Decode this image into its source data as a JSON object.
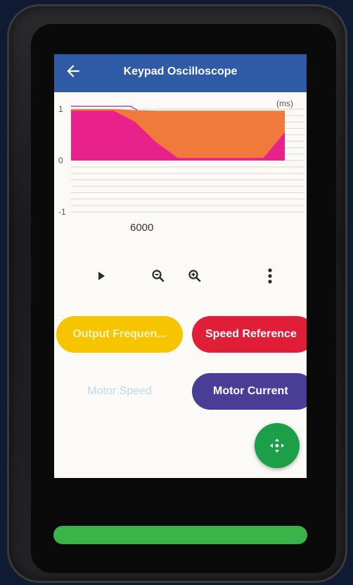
{
  "appbar": {
    "title": "Keypad Oscilloscope",
    "back_icon": "arrow-left-icon"
  },
  "chart": {
    "unit_label": "(ms)",
    "y_ticks": [
      "1",
      "0",
      "-1"
    ],
    "time_value": "6000"
  },
  "chart_data": {
    "type": "area",
    "title": "",
    "xlabel": "(ms)",
    "ylabel": "",
    "ylim": [
      -1,
      1
    ],
    "y_ticks": [
      1,
      0,
      -1
    ],
    "x": [
      0,
      1,
      2,
      3,
      4,
      5,
      6,
      7,
      8,
      9,
      10
    ],
    "series": [
      {
        "color": "#f07a3c",
        "values": [
          1,
          1,
          1,
          0.98,
          0.97,
          0.97,
          0.97,
          0.97,
          0.97,
          0.97,
          0.97
        ]
      },
      {
        "color": "#e8228a",
        "values": [
          0.97,
          0.97,
          0.97,
          0.75,
          0.35,
          0.05,
          0.05,
          0.05,
          0.05,
          0.05,
          0.55
        ]
      }
    ],
    "grid": true
  },
  "toolbar": {
    "play_icon": "play-icon",
    "zoom_out_icon": "zoom-out-icon",
    "zoom_in_icon": "zoom-in-icon",
    "more_icon": "more-vertical-icon"
  },
  "signals": {
    "output_frequency": "Output Frequen...",
    "speed_reference": "Speed Reference",
    "motor_speed": "Motor Speed",
    "motor_current": "Motor Current"
  },
  "fab": {
    "icon": "move-arrows-icon"
  },
  "colors": {
    "appbar": "#2f5aa6",
    "output_frequency": "#f7c500",
    "speed_reference": "#e01e37",
    "motor_speed": "#b9dcea",
    "motor_current": "#4a3d96",
    "fab": "#1c9f48",
    "home_bar": "#38b449"
  }
}
